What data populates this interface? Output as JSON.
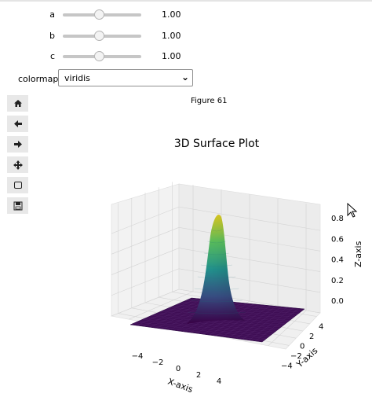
{
  "sliders": [
    {
      "label": "a",
      "value": "1.00",
      "fraction": 0.5
    },
    {
      "label": "b",
      "value": "1.00",
      "fraction": 0.5
    },
    {
      "label": "c",
      "value": "1.00",
      "fraction": 0.5
    }
  ],
  "colormap": {
    "label": "colormap",
    "selected": "viridis"
  },
  "toolbar": {
    "icons": [
      "home-icon",
      "back-arrow-icon",
      "forward-arrow-icon",
      "pan-move-icon",
      "zoom-rectangle-icon",
      "save-icon"
    ]
  },
  "figure": {
    "label": "Figure 61"
  },
  "chart_data": {
    "type": "surface",
    "title": "3D Surface Plot",
    "xlabel": "X-axis",
    "ylabel": "Y-axis",
    "zlabel": "Z-axis",
    "xlim": [
      -5,
      5
    ],
    "ylim": [
      -5,
      5
    ],
    "zlim": [
      0,
      0.9
    ],
    "xticks": [
      "−4",
      "−2",
      "0",
      "2",
      "4"
    ],
    "yticks": [
      "−4",
      "−2",
      "0",
      "2",
      "4"
    ],
    "zticks": [
      "0.0",
      "0.2",
      "0.4",
      "0.6",
      "0.8"
    ],
    "peak": {
      "x": 0,
      "y": 0,
      "z": 0.85
    },
    "colormap": "viridis",
    "grid": true
  }
}
